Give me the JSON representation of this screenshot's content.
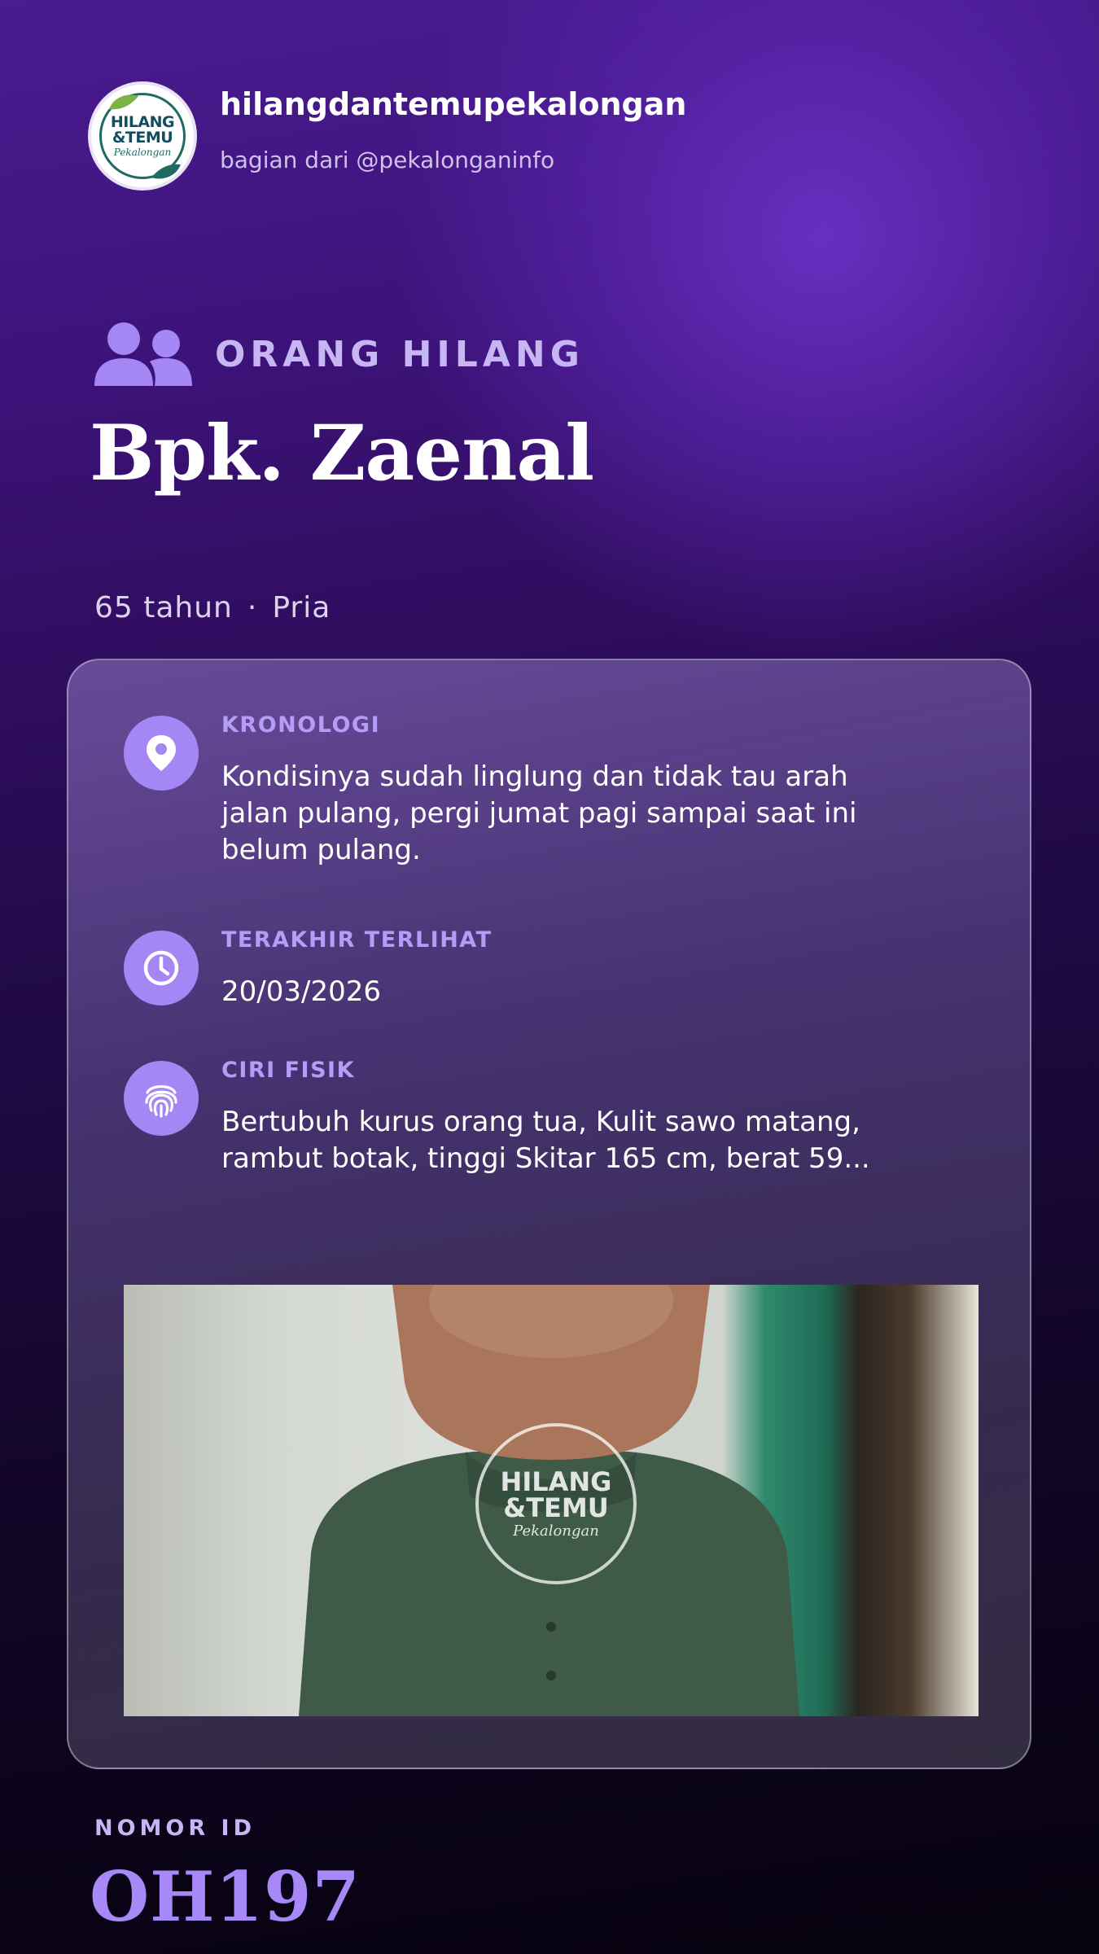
{
  "header": {
    "account_name": "hilangdantemupekalongan",
    "subtitle": "bagian dari @pekalonganinfo",
    "logo": {
      "line1": "HILANG",
      "line2": "&TEMU",
      "line3": "Pekalongan"
    }
  },
  "category": {
    "icon": "users-icon",
    "label": "ORANG HILANG"
  },
  "person": {
    "name": "Bpk. Zaenal",
    "age": "65 tahun",
    "separator": "·",
    "gender": "Pria"
  },
  "details": [
    {
      "icon": "map-pin-icon",
      "title": "KRONOLOGI",
      "text": "Kondisinya sudah linglung dan tidak tau arah jalan pulang, pergi jumat pagi sampai saat ini belum pulang."
    },
    {
      "icon": "clock-icon",
      "title": "TERAKHIR TERLIHAT",
      "text": "20/03/2026"
    },
    {
      "icon": "fingerprint-icon",
      "title": "CIRI FISIK",
      "text": "Bertubuh kurus orang tua, Kulit sawo matang, rambut botak, tinggi Skitar 165 cm, berat 59..."
    }
  ],
  "photo": {
    "watermark": {
      "line1": "HILANG",
      "line2": "&TEMU",
      "line3": "Pekalongan"
    }
  },
  "id": {
    "label": "NOMOR ID",
    "value": "OH197"
  },
  "colors": {
    "accent": "#a486f4",
    "accent_text": "#b69cf6",
    "id_value": "#a688f6",
    "background_top": "#4a1b91",
    "background_bottom": "#06020e"
  }
}
